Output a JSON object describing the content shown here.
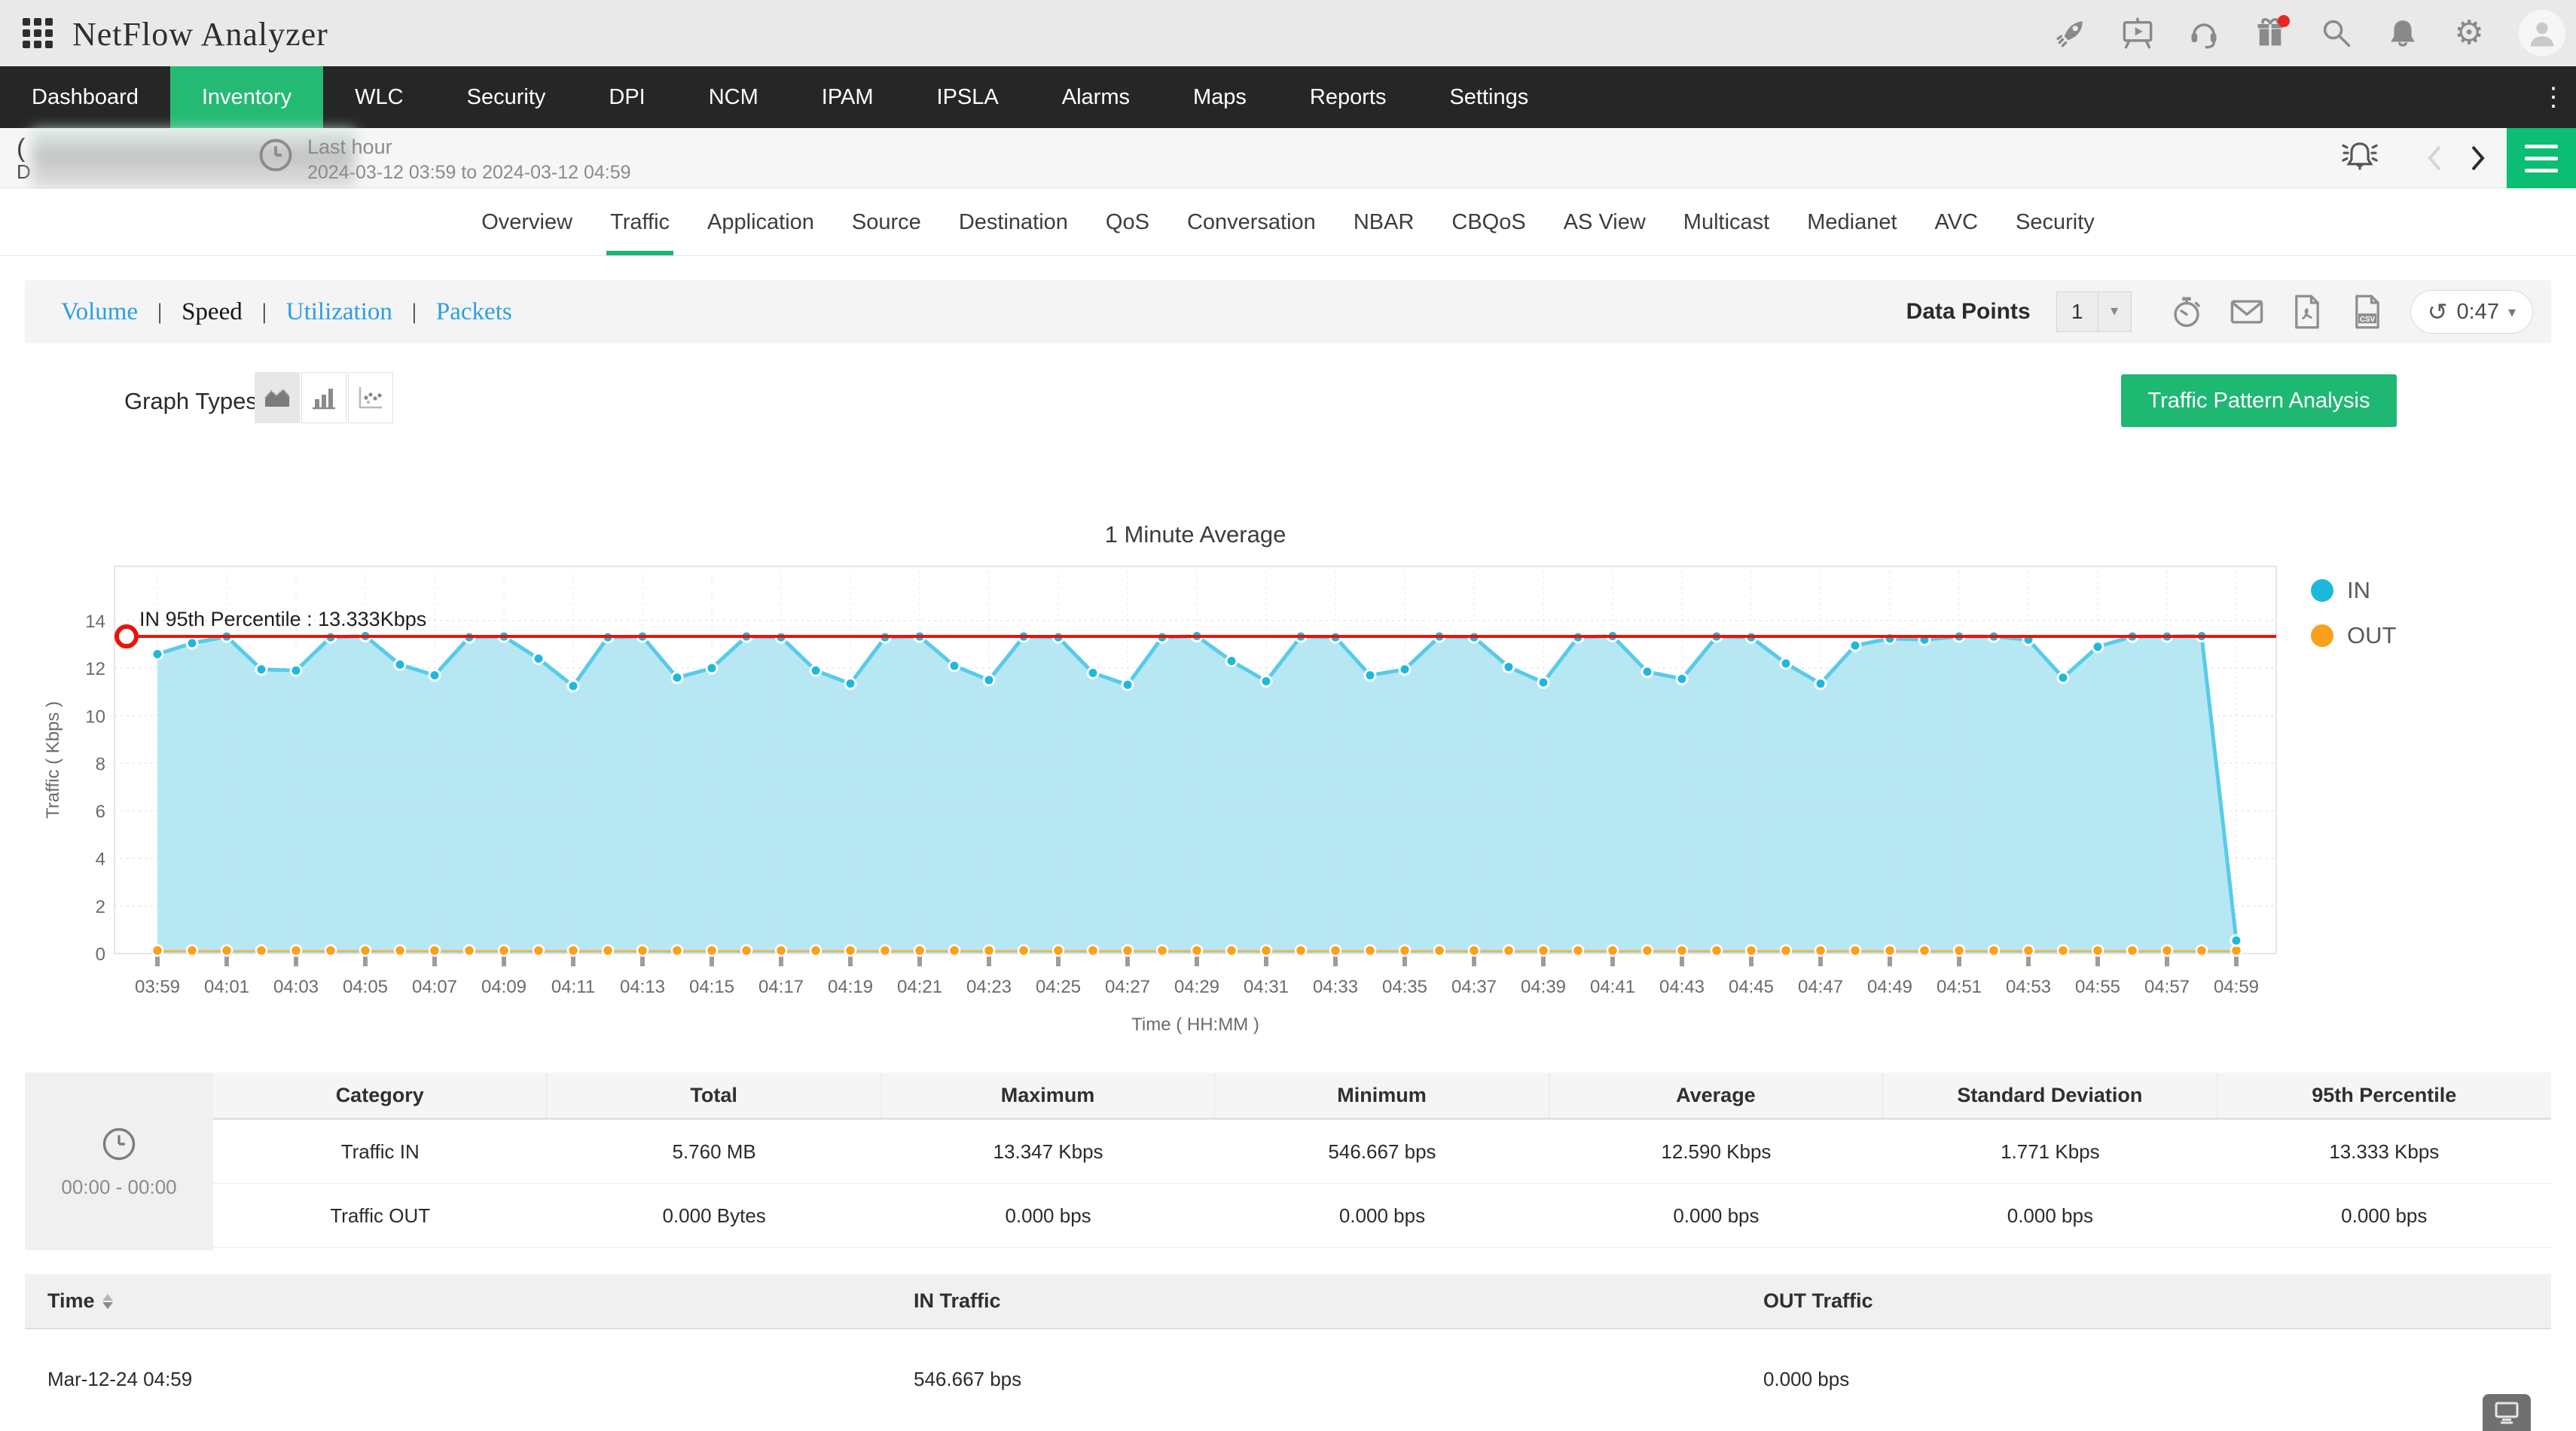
{
  "header": {
    "title": "NetFlow Analyzer"
  },
  "nav": {
    "items": [
      "Dashboard",
      "Inventory",
      "WLC",
      "Security",
      "DPI",
      "NCM",
      "IPAM",
      "IPSLA",
      "Alarms",
      "Maps",
      "Reports",
      "Settings"
    ],
    "active_index": 1
  },
  "subheader": {
    "masked_prefix": "(",
    "masked_second_char": "D",
    "period_label": "Last hour",
    "period_range": "2024-03-12 03:59 to 2024-03-12 04:59"
  },
  "tabs": {
    "items": [
      "Overview",
      "Traffic",
      "Application",
      "Source",
      "Destination",
      "QoS",
      "Conversation",
      "NBAR",
      "CBQoS",
      "AS View",
      "Multicast",
      "Medianet",
      "AVC",
      "Security"
    ],
    "active_index": 1
  },
  "report_links": {
    "items": [
      "Volume",
      "Speed",
      "Utilization",
      "Packets"
    ],
    "active_index": 1
  },
  "toolbar": {
    "data_points_label": "Data Points",
    "data_points_value": "1",
    "refresh_timer": "0:47"
  },
  "graph_controls": {
    "label": "Graph Types",
    "pattern_button": "Traffic Pattern Analysis"
  },
  "chart_data": {
    "type": "area",
    "title": "1 Minute Average",
    "xlabel": "Time ( HH:MM )",
    "ylabel": "Traffic ( Kbps )",
    "ylim": [
      0,
      14
    ],
    "yticks": [
      0,
      2,
      4,
      6,
      8,
      10,
      12,
      14
    ],
    "x_tick_labels": [
      "03:59",
      "04:01",
      "04:03",
      "04:05",
      "04:07",
      "04:09",
      "04:11",
      "04:13",
      "04:15",
      "04:17",
      "04:19",
      "04:21",
      "04:23",
      "04:25",
      "04:27",
      "04:29",
      "04:31",
      "04:33",
      "04:35",
      "04:37",
      "04:39",
      "04:41",
      "04:43",
      "04:45",
      "04:47",
      "04:49",
      "04:51",
      "04:53",
      "04:55",
      "04:57",
      "04:59"
    ],
    "minutes_per_point": 1,
    "grid": true,
    "legend_position": "right",
    "series": [
      {
        "name": "IN",
        "color": "#1db9dd",
        "values": [
          12.59,
          13.05,
          13.33,
          11.95,
          11.9,
          13.3,
          13.35,
          12.15,
          11.7,
          13.3,
          13.33,
          12.4,
          11.25,
          13.3,
          13.33,
          11.6,
          12.0,
          13.33,
          13.3,
          11.9,
          11.35,
          13.3,
          13.33,
          12.1,
          11.5,
          13.33,
          13.3,
          11.8,
          11.3,
          13.3,
          13.35,
          12.3,
          11.45,
          13.33,
          13.3,
          11.7,
          11.95,
          13.33,
          13.3,
          12.05,
          11.4,
          13.3,
          13.35,
          11.85,
          11.55,
          13.33,
          13.3,
          12.2,
          11.35,
          12.95,
          13.25,
          13.2,
          13.33,
          13.33,
          13.2,
          11.6,
          12.9,
          13.33,
          13.33,
          13.35,
          0.547
        ]
      },
      {
        "name": "OUT",
        "color": "#f9a11b",
        "constant_value": 0
      }
    ],
    "annotation": {
      "text": "IN 95th Percentile : 13.333Kbps",
      "value": 13.333,
      "color": "#e8130c"
    },
    "legend": [
      "IN",
      "OUT"
    ]
  },
  "summary_table": {
    "time_cell": "00:00 - 00:00",
    "columns": [
      "Category",
      "Total",
      "Maximum",
      "Minimum",
      "Average",
      "Standard Deviation",
      "95th Percentile"
    ],
    "rows": [
      [
        "Traffic IN",
        "5.760 MB",
        "13.347 Kbps",
        "546.667 bps",
        "12.590 Kbps",
        "1.771 Kbps",
        "13.333 Kbps"
      ],
      [
        "Traffic OUT",
        "0.000 Bytes",
        "0.000 bps",
        "0.000 bps",
        "0.000 bps",
        "0.000 bps",
        "0.000 bps"
      ]
    ]
  },
  "detail_table": {
    "columns": [
      "Time",
      "IN Traffic",
      "OUT Traffic"
    ],
    "rows": [
      [
        "Mar-12-24 04:59",
        "546.667 bps",
        "0.000 bps"
      ]
    ]
  }
}
